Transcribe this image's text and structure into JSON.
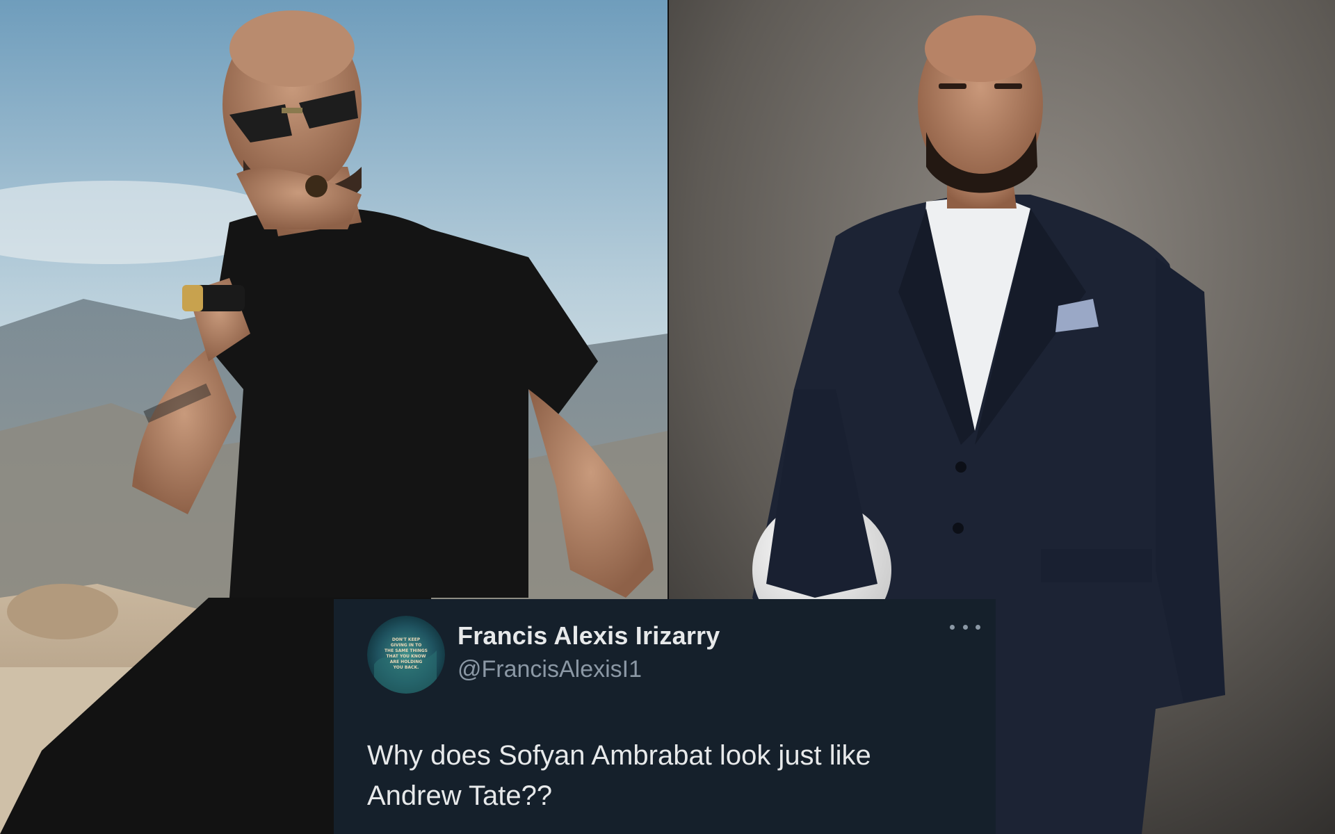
{
  "tweet": {
    "display_name": "Francis Alexis Irizarry",
    "handle": "@FrancisAlexisI1",
    "text": "Why does Sofyan Ambrabat look just like Andrew Tate??",
    "more_icon": "ellipsis-icon",
    "avatar_text": [
      "DON'T KEEP",
      "GIVING IN TO",
      "THE SAME THINGS",
      "THAT YOU KNOW",
      "ARE HOLDING",
      "YOU BACK."
    ]
  },
  "colors": {
    "card_background": "#15202b",
    "name_text": "#e7e9ea",
    "handle_text": "#8b98a5"
  }
}
